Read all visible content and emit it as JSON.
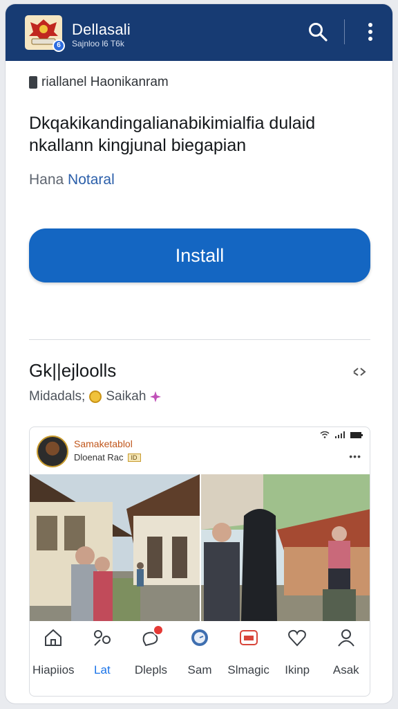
{
  "header": {
    "title": "Dellasali",
    "subtitle": "Sajnloo l6 T6k",
    "logo_badge": "6"
  },
  "info": {
    "category": "riallanel Haonikanram",
    "headline": "Dkqakikandingalianabikimialfia dulaid nkallann kingjunal biegapian",
    "publisher_prefix": "Hana",
    "publisher_name": "Notaral",
    "install_label": "Install"
  },
  "section": {
    "title": "Gk||ejloolls",
    "meta_left": "Midadals;",
    "meta_right": "Saikah"
  },
  "preview": {
    "name": "Samaketablol",
    "sub": "Dloenat Rac",
    "tag": "ID"
  },
  "nav": {
    "items": [
      {
        "label": "Hiapiios",
        "icon": "home-icon"
      },
      {
        "label": "Lat",
        "icon": "grid-icon"
      },
      {
        "label": "Dlepls",
        "icon": "bubble-icon"
      },
      {
        "label": "Sam",
        "icon": "clock-icon"
      },
      {
        "label": "Slmagic",
        "icon": "tv-icon"
      },
      {
        "label": "Ikinp",
        "icon": "heart-icon"
      },
      {
        "label": "Asak",
        "icon": "person-icon"
      }
    ],
    "active_index": 1
  },
  "colors": {
    "header_bg": "#173b73",
    "accent": "#1466c2",
    "link": "#2b5faa",
    "badge": "#e53935"
  }
}
